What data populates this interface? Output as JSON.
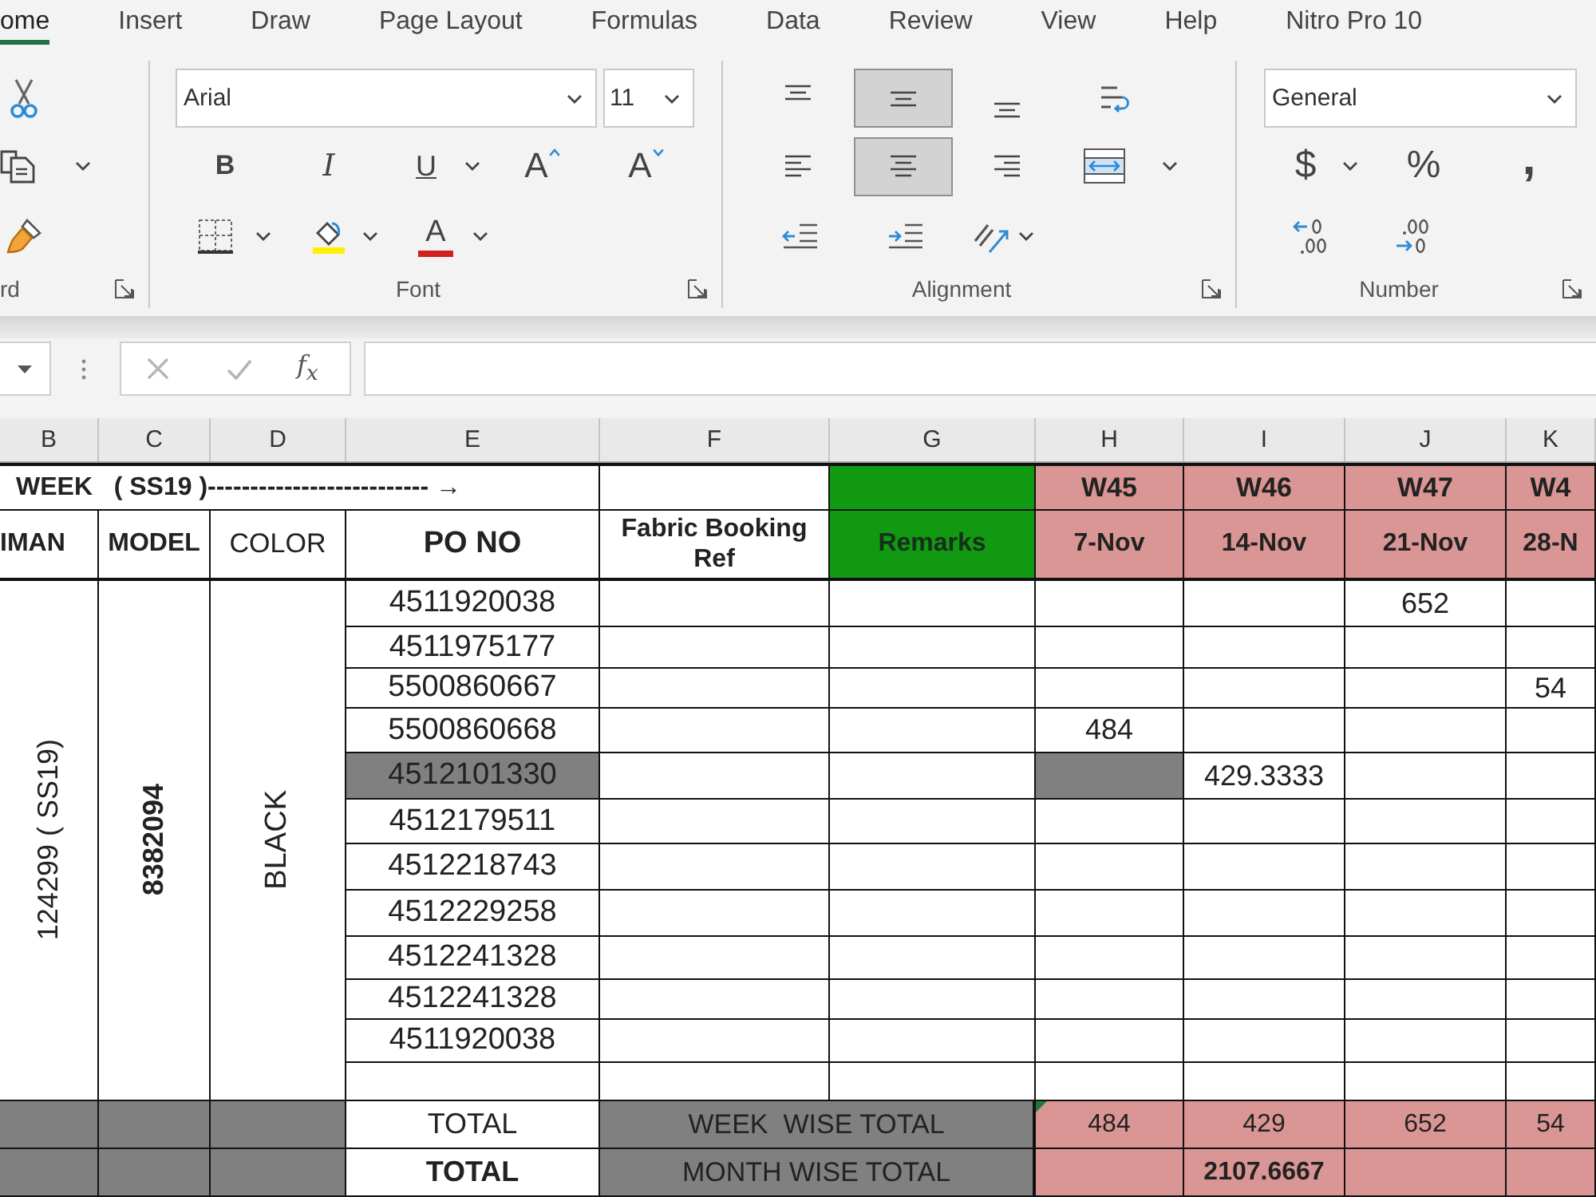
{
  "ribbon": {
    "tabs": [
      {
        "label": "ome",
        "selected": true
      },
      {
        "label": "Insert",
        "selected": false
      },
      {
        "label": "Draw",
        "selected": false
      },
      {
        "label": "Page Layout",
        "selected": false
      },
      {
        "label": "Formulas",
        "selected": false
      },
      {
        "label": "Data",
        "selected": false
      },
      {
        "label": "Review",
        "selected": false
      },
      {
        "label": "View",
        "selected": false
      },
      {
        "label": "Help",
        "selected": false
      },
      {
        "label": "Nitro Pro 10",
        "selected": false
      }
    ],
    "clipboard": {
      "label": "rd"
    },
    "font": {
      "label": "Font",
      "font_name": "Arial",
      "font_size": "11",
      "style_buttons": [
        {
          "kind": "bold",
          "label": "B"
        },
        {
          "kind": "italic",
          "label": "I"
        },
        {
          "kind": "underline",
          "label": "U"
        }
      ],
      "size_buttons": [
        {
          "kind": "grow",
          "label": "A"
        },
        {
          "kind": "shrink",
          "label": "A"
        }
      ],
      "font_color_label": "A"
    },
    "alignment": {
      "label": "Alignment",
      "vertical": [
        {
          "kind": "top",
          "selected": false
        },
        {
          "kind": "middle",
          "selected": true
        },
        {
          "kind": "bottom",
          "selected": false
        }
      ],
      "horizontal": [
        {
          "kind": "left",
          "selected": false
        },
        {
          "kind": "center",
          "selected": true
        },
        {
          "kind": "right",
          "selected": false
        }
      ]
    },
    "number": {
      "label": "Number",
      "format": "General",
      "symbols": [
        {
          "kind": "currency",
          "label": "$"
        },
        {
          "kind": "percent",
          "label": "%"
        },
        {
          "kind": "comma",
          "label": ","
        }
      ]
    }
  },
  "formula_bar": {
    "function_label": "f$_{x}$"
  },
  "sheet": {
    "column_headers": [
      "B",
      "C",
      "D",
      "E",
      "F",
      "G",
      "H",
      "I",
      "J",
      "K"
    ],
    "title_row": {
      "title": "WEEK   ( SS19 )-------------------------- →",
      "weeks": [
        "W45",
        "W46",
        "W47",
        "W4"
      ]
    },
    "headings": {
      "column_1": "IMAN",
      "model": "MODEL",
      "color_heading": "COLOR",
      "po_no": "PO NO",
      "fabric_booking_ref": "Fabric Booking Ref",
      "remarks": "Remarks",
      "dates": [
        "7-Nov",
        "14-Nov",
        "21-Nov",
        "28-N"
      ]
    },
    "group": {
      "column_1": "124299 ( SS19)",
      "model": "8382094",
      "color_name": "BLACK"
    },
    "rows": [
      {
        "po_no": "4511920038",
        "shaded": false,
        "weeks": [
          {
            "shaded": false
          },
          {
            "shaded": false
          },
          {
            "value": "652",
            "shaded": false
          },
          {
            "shaded": false
          }
        ]
      },
      {
        "po_no": "4511975177",
        "shaded": false,
        "weeks": [
          {
            "shaded": false
          },
          {
            "shaded": false
          },
          {
            "shaded": false
          },
          {
            "shaded": false
          }
        ]
      },
      {
        "po_no": "5500860667",
        "shaded": false,
        "weeks": [
          {
            "shaded": false
          },
          {
            "shaded": false
          },
          {
            "shaded": false
          },
          {
            "value": "54",
            "shaded": false
          }
        ]
      },
      {
        "po_no": "5500860668",
        "shaded": false,
        "weeks": [
          {
            "value": "484",
            "shaded": false
          },
          {
            "shaded": false
          },
          {
            "shaded": false
          },
          {
            "shaded": false
          }
        ]
      },
      {
        "po_no": "4512101330",
        "shaded": true,
        "weeks": [
          {
            "shaded": true
          },
          {
            "value": "429.3333",
            "shaded": false
          },
          {
            "shaded": false
          },
          {
            "shaded": false
          }
        ]
      },
      {
        "po_no": "4512179511",
        "shaded": false,
        "weeks": [
          {
            "shaded": false
          },
          {
            "shaded": false
          },
          {
            "shaded": false
          },
          {
            "shaded": false
          }
        ]
      },
      {
        "po_no": "4512218743",
        "shaded": false,
        "weeks": [
          {
            "shaded": false
          },
          {
            "shaded": false
          },
          {
            "shaded": false
          },
          {
            "shaded": false
          }
        ]
      },
      {
        "po_no": "4512229258",
        "shaded": false,
        "weeks": [
          {
            "shaded": false
          },
          {
            "shaded": false
          },
          {
            "shaded": false
          },
          {
            "shaded": false
          }
        ]
      },
      {
        "po_no": "4512241328",
        "shaded": false,
        "weeks": [
          {
            "shaded": false
          },
          {
            "shaded": false
          },
          {
            "shaded": false
          },
          {
            "shaded": false
          }
        ]
      },
      {
        "po_no": "4512241328",
        "shaded": false,
        "weeks": [
          {
            "shaded": false
          },
          {
            "shaded": false
          },
          {
            "shaded": false
          },
          {
            "shaded": false
          }
        ]
      },
      {
        "po_no": "4511920038",
        "shaded": false,
        "weeks": [
          {
            "shaded": false
          },
          {
            "shaded": false
          },
          {
            "shaded": false
          },
          {
            "shaded": false
          }
        ]
      },
      {
        "shaded": false,
        "weeks": [
          {
            "shaded": false
          },
          {
            "shaded": false
          },
          {
            "shaded": false
          },
          {
            "shaded": false
          }
        ]
      }
    ],
    "totals": [
      {
        "kind": "week",
        "label": "TOTAL",
        "caption": "WEEK  WISE TOTAL",
        "weeks": [
          {
            "value": "484",
            "flagged": true
          },
          {
            "value": "429",
            "flagged": false
          },
          {
            "value": "652",
            "flagged": false
          },
          {
            "value": "54",
            "flagged": false
          }
        ]
      },
      {
        "kind": "month",
        "label": "TOTAL",
        "caption": "MONTH WISE TOTAL",
        "weeks": [
          {
            "flagged": false
          },
          {
            "value": "2107.6667",
            "flagged": false
          },
          {
            "flagged": false
          },
          {
            "flagged": false
          }
        ]
      }
    ]
  }
}
